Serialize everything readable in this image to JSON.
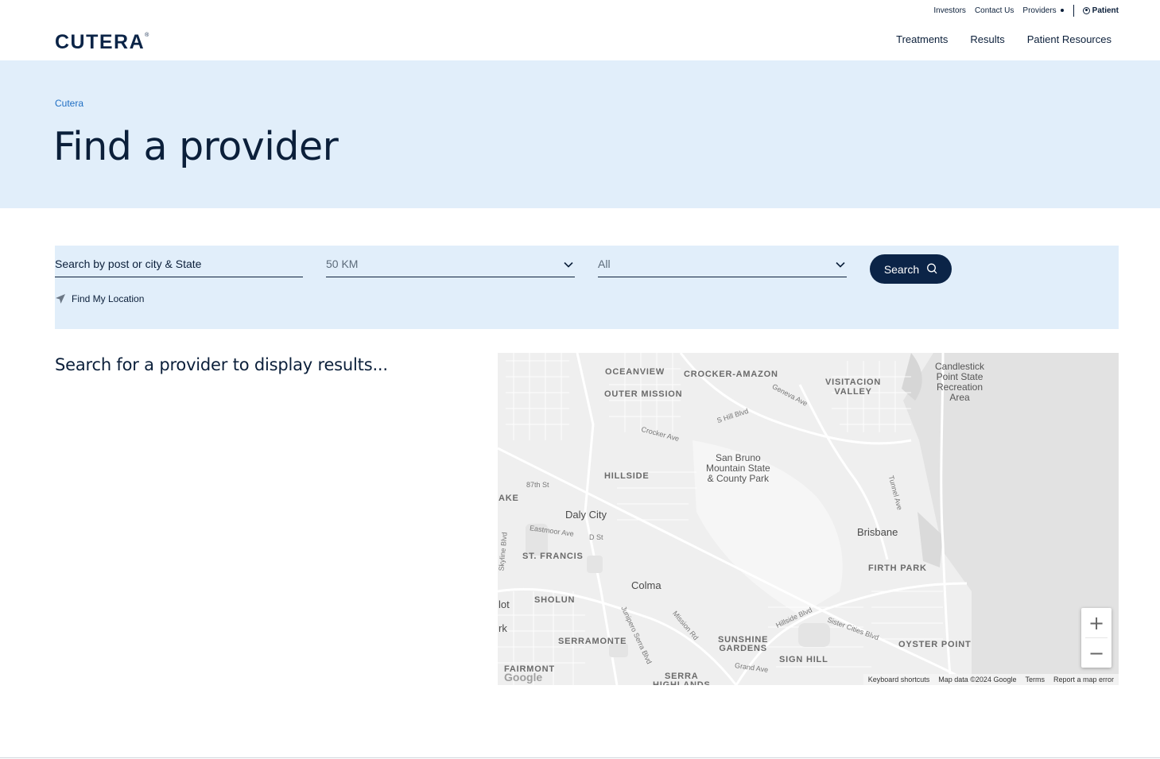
{
  "utility": {
    "links": [
      "Investors",
      "Contact Us",
      "Providers"
    ],
    "patient_label": "Patient"
  },
  "header": {
    "logo": "CUTERA",
    "nav": [
      "Treatments",
      "Results",
      "Patient Resources"
    ]
  },
  "hero": {
    "breadcrumb": "Cutera",
    "title": "Find a provider"
  },
  "search": {
    "location_value": "Search by post or city & State",
    "distance_value": "50 KM",
    "category_value": "All",
    "search_button": "Search",
    "find_location": "Find My Location"
  },
  "results": {
    "prompt": "Search for a provider to display results..."
  },
  "map": {
    "labels": {
      "oceanview": "OCEANVIEW",
      "crocker": "CROCKER-AMAZON",
      "visitacion": "VISITACION\nVALLEY",
      "candlestick": "Candlestick\nPoint State\nRecreation\nArea",
      "outer_mission": "OUTER MISSION",
      "geneva": "Geneva Ave",
      "hill_blvd": "S Hill Blvd",
      "crocker_ave": "Crocker Ave",
      "san_bruno": "San Bruno\nMountain State\n& County Park",
      "hillside": "HILLSIDE",
      "st87": "87th St",
      "lake": "AKE",
      "daly_city": "Daly City",
      "eastmoor": "Eastmoor Ave",
      "dst": "D St",
      "tunnel": "Tunnel Ave",
      "brisbane": "Brisbane",
      "skyline": "Skyline Blvd",
      "st_francis": "ST. FRANCIS",
      "firth_park": "FIRTH PARK",
      "colma": "Colma",
      "lot": "lot",
      "sholun": "SHOLUN",
      "rk": "rk",
      "serramonte": "SERRAMONTE",
      "junipero": "Junipero Serra Blvd",
      "mission_rd": "Mission Rd",
      "hillside_blvd": "Hillside Blvd",
      "sister_cities": "Sister Cities Blvd",
      "sunshine": "SUNSHINE\nGARDENS",
      "oyster": "OYSTER POINT",
      "sign_hill": "SIGN HILL",
      "grand": "Grand Ave",
      "fairmont": "FAIRMONT",
      "serra": "SERRA\nHIGHLANDS"
    },
    "zoom_in": "+",
    "zoom_out": "−",
    "google": "Google",
    "attribution": [
      "Keyboard shortcuts",
      "Map data ©2024 Google",
      "Terms",
      "Report a map error"
    ]
  }
}
